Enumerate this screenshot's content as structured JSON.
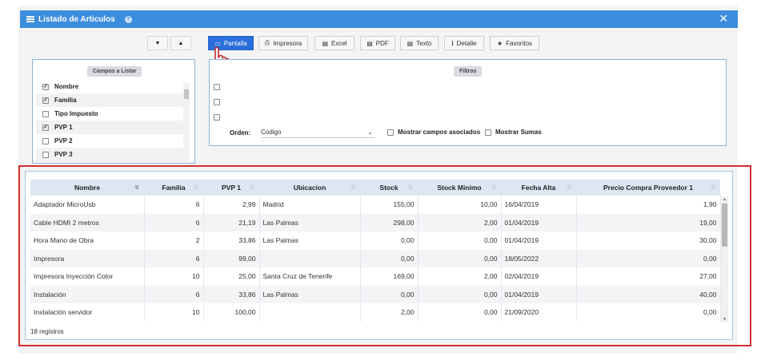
{
  "window": {
    "title": "Listado de Articulos",
    "close_icon": "close-icon",
    "help_icon": "help-icon"
  },
  "sort_buttons": {
    "down": "▼",
    "up": "▲"
  },
  "toolbar": [
    {
      "icon": "monitor-icon",
      "glyph": "▭",
      "label": "Pantalla",
      "active": true
    },
    {
      "icon": "printer-icon",
      "glyph": "⎙",
      "label": "Impresora",
      "active": false
    },
    {
      "icon": "excel-icon",
      "glyph": "▤",
      "label": "Excel",
      "active": false
    },
    {
      "icon": "pdf-icon",
      "glyph": "▤",
      "label": "PDF",
      "active": false
    },
    {
      "icon": "text-icon",
      "glyph": "▤",
      "label": "Texto",
      "active": false
    },
    {
      "icon": "info-icon",
      "glyph": "i",
      "label": "Detalle",
      "active": false
    },
    {
      "icon": "star-icon",
      "glyph": "★",
      "label": "Favoritos",
      "active": false
    }
  ],
  "campos": {
    "title": "Campos a Listar",
    "items": [
      {
        "label": "Nombre",
        "checked": true
      },
      {
        "label": "Familia",
        "checked": true
      },
      {
        "label": "Tipo Impuesto",
        "checked": false
      },
      {
        "label": "PVP 1",
        "checked": true
      },
      {
        "label": "PVP 2",
        "checked": false
      },
      {
        "label": "PVP 3",
        "checked": false
      }
    ]
  },
  "filtros": {
    "title": "Filtros",
    "orden_label": "Orden:",
    "orden_value": "Codigo",
    "mostrar_campos": "Mostrar campos asociados",
    "mostrar_sumas": "Mostrar Sumas"
  },
  "table": {
    "columns": [
      "Nombre",
      "Familia",
      "PVP 1",
      "Ubicacion",
      "Stock",
      "Stock Minimo",
      "Fecha Alta",
      "Precio Compra Proveedor 1"
    ],
    "rows": [
      [
        "Adaptador MicroUsb",
        "6",
        "2,99",
        "Madrid",
        "155,00",
        "10,00",
        "16/04/2019",
        "1,90"
      ],
      [
        "Cable HDMI 2 metros",
        "6",
        "21,19",
        "Las Palmas",
        "298,00",
        "2,00",
        "01/04/2019",
        "19,00"
      ],
      [
        "Hora Mano de Obra",
        "2",
        "33,86",
        "Las Palmas",
        "0,00",
        "0,00",
        "01/04/2019",
        "30,00"
      ],
      [
        "Impresora",
        "6",
        "99,00",
        "",
        "0,00",
        "0,00",
        "18/05/2022",
        "0,00"
      ],
      [
        "Impresora Inyección Color",
        "10",
        "25,00",
        "Santa Cruz de Tenerife",
        "169,00",
        "2,00",
        "02/04/2019",
        "27,00"
      ],
      [
        "Instalación",
        "6",
        "33,86",
        "Las Palmas",
        "0,00",
        "0,00",
        "01/04/2019",
        "40,00"
      ],
      [
        "Instalación servidor",
        "10",
        "100,00",
        "",
        "2,00",
        "0,00",
        "21/09/2020",
        "0,00"
      ]
    ],
    "footer": "18 registros"
  },
  "colors": {
    "titlebar": "#3c8dde",
    "active_button": "#2a6fdb",
    "highlight_border": "#d32f2f",
    "header_bg": "#dde6f3"
  }
}
